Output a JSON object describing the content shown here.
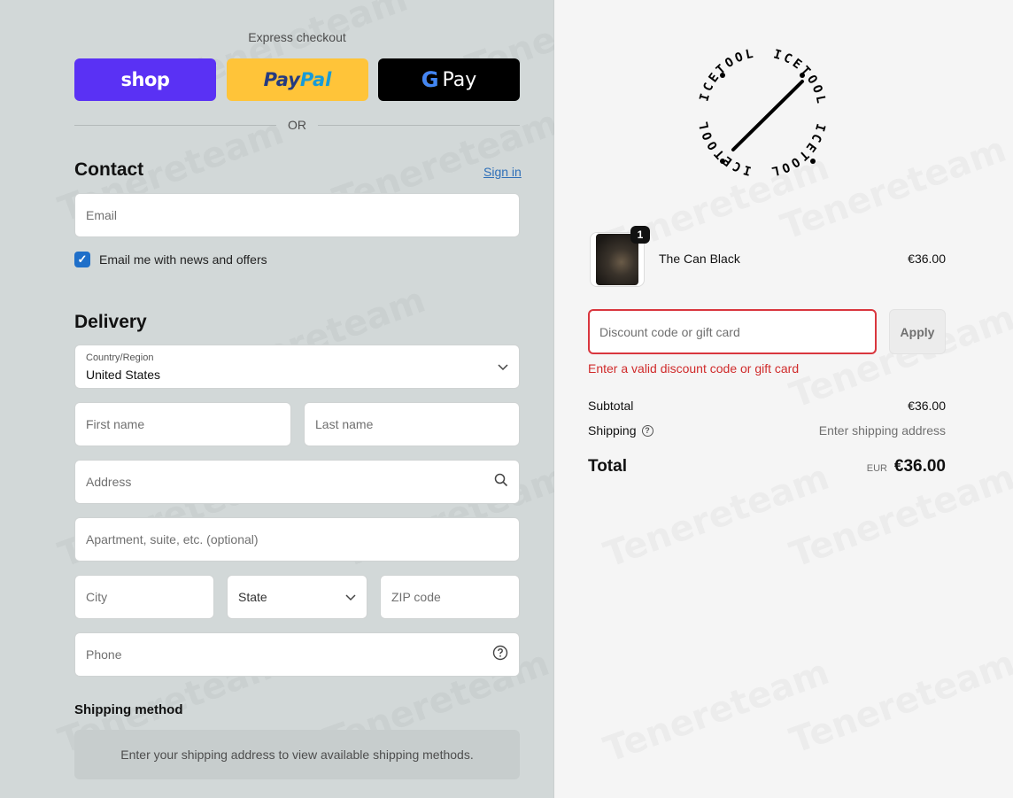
{
  "express": {
    "label": "Express checkout",
    "shop_label": "shop",
    "paypal_pay": "Pay",
    "paypal_pal": "Pal",
    "gpay_g": "G",
    "gpay_pay": "Pay",
    "or_label": "OR"
  },
  "contact": {
    "title": "Contact",
    "signin_label": "Sign in",
    "email_placeholder": "Email",
    "newsletter_label": "Email me with news and offers",
    "newsletter_checked": true
  },
  "delivery": {
    "title": "Delivery",
    "country_label": "Country/Region",
    "country_value": "United States",
    "first_name_placeholder": "First name",
    "last_name_placeholder": "Last name",
    "address_placeholder": "Address",
    "apartment_placeholder": "Apartment, suite, etc. (optional)",
    "city_placeholder": "City",
    "state_placeholder": "State",
    "zip_placeholder": "ZIP code",
    "phone_placeholder": "Phone"
  },
  "shipping_method": {
    "title": "Shipping method",
    "message": "Enter your shipping address to view available shipping methods."
  },
  "brand": {
    "logo_text": "ICETOOL"
  },
  "order": {
    "item": {
      "quantity": "1",
      "name": "The Can Black",
      "price": "€36.00"
    },
    "discount_placeholder": "Discount code or gift card",
    "apply_label": "Apply",
    "discount_error": "Enter a valid discount code or gift card",
    "subtotal_label": "Subtotal",
    "subtotal_value": "€36.00",
    "shipping_label": "Shipping",
    "shipping_value": "Enter shipping address",
    "total_label": "Total",
    "total_currency": "EUR",
    "total_value": "€36.00"
  },
  "watermark": "Tenereteam",
  "colors": {
    "shop_purple": "#5a31f4",
    "paypal_yellow": "#ffc439",
    "checkbox_blue": "#1f6fc9",
    "error_red": "#d9363e",
    "link_blue": "#2e6fb8"
  }
}
